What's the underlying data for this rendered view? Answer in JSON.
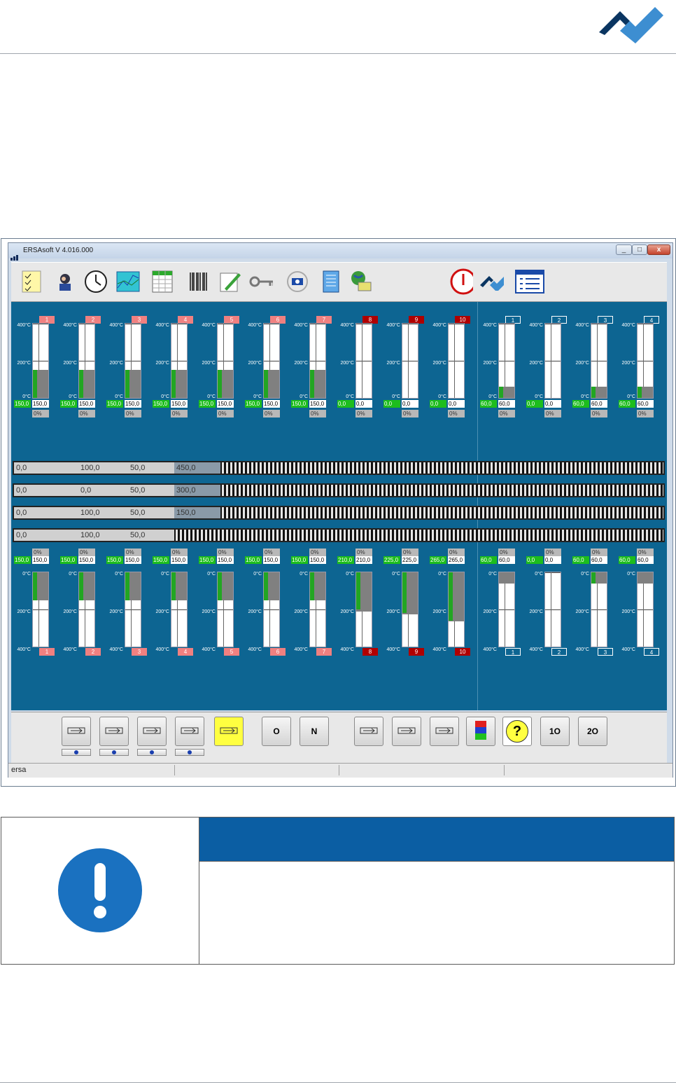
{
  "app": {
    "title": "ERSAsoft V 4.016.000",
    "status_text": "ersa"
  },
  "window_controls": {
    "minimize": "_",
    "maximize": "□",
    "close": "x"
  },
  "colors": {
    "panel_bg": "#0d6592",
    "accent_blue": "#0b5ea3",
    "logo_dark": "#0a3561",
    "logo_light": "#3d8ed1"
  },
  "toolbar_icons": [
    "checklist-icon",
    "operator-icon",
    "clock-icon",
    "profile-chart-icon",
    "spreadsheet-icon",
    "barcode-icon",
    "edit-pencil-icon",
    "key-icon",
    "camera-cycle-icon",
    "notes-icon",
    "network-icon",
    "power-stop-icon",
    "ersa-logo-icon",
    "list-view-icon"
  ],
  "top_zones": [
    {
      "num": "1",
      "color": "pink",
      "set": "150,0",
      "act": "150,0",
      "pct": "0%",
      "fill": 0.375,
      "green": 0.375
    },
    {
      "num": "2",
      "color": "pink",
      "set": "150,0",
      "act": "150,0",
      "pct": "0%",
      "fill": 0.375,
      "green": 0.375
    },
    {
      "num": "3",
      "color": "pink",
      "set": "150,0",
      "act": "150,0",
      "pct": "0%",
      "fill": 0.375,
      "green": 0.375
    },
    {
      "num": "4",
      "color": "pink",
      "set": "150,0",
      "act": "150,0",
      "pct": "0%",
      "fill": 0.375,
      "green": 0.375
    },
    {
      "num": "5",
      "color": "pink",
      "set": "150,0",
      "act": "150,0",
      "pct": "0%",
      "fill": 0.375,
      "green": 0.375
    },
    {
      "num": "6",
      "color": "pink",
      "set": "150,0",
      "act": "150,0",
      "pct": "0%",
      "fill": 0.375,
      "green": 0.375
    },
    {
      "num": "7",
      "color": "pink",
      "set": "150,0",
      "act": "150,0",
      "pct": "0%",
      "fill": 0.375,
      "green": 0.375
    },
    {
      "num": "8",
      "color": "red",
      "set": "0,0",
      "act": "0,0",
      "pct": "0%",
      "fill": 0,
      "green": 0
    },
    {
      "num": "9",
      "color": "red",
      "set": "0,0",
      "act": "0,0",
      "pct": "0%",
      "fill": 0,
      "green": 0
    },
    {
      "num": "10",
      "color": "red",
      "set": "0,0",
      "act": "0,0",
      "pct": "0%",
      "fill": 0,
      "green": 0
    },
    {
      "num": "1",
      "color": "blue",
      "set": "60,0",
      "act": "60,0",
      "pct": "0%",
      "fill": 0.15,
      "green": 0.15
    },
    {
      "num": "2",
      "color": "blue",
      "set": "0,0",
      "act": "0,0",
      "pct": "0%",
      "fill": 0,
      "green": 0
    },
    {
      "num": "3",
      "color": "blue",
      "set": "60,0",
      "act": "60,0",
      "pct": "0%",
      "fill": 0.15,
      "green": 0.15
    },
    {
      "num": "4",
      "color": "blue",
      "set": "60,0",
      "act": "60,0",
      "pct": "0%",
      "fill": 0.15,
      "green": 0.15
    }
  ],
  "bottom_zones": [
    {
      "num": "1",
      "color": "pink",
      "set": "150,0",
      "act": "150,0",
      "pct": "0%",
      "fill": 0.375,
      "green": 0.375
    },
    {
      "num": "2",
      "color": "pink",
      "set": "150,0",
      "act": "150,0",
      "pct": "0%",
      "fill": 0.375,
      "green": 0.375
    },
    {
      "num": "3",
      "color": "pink",
      "set": "150,0",
      "act": "150,0",
      "pct": "0%",
      "fill": 0.375,
      "green": 0.375
    },
    {
      "num": "4",
      "color": "pink",
      "set": "150,0",
      "act": "150,0",
      "pct": "0%",
      "fill": 0.375,
      "green": 0.375
    },
    {
      "num": "5",
      "color": "pink",
      "set": "150,0",
      "act": "150,0",
      "pct": "0%",
      "fill": 0.375,
      "green": 0.375
    },
    {
      "num": "6",
      "color": "pink",
      "set": "150,0",
      "act": "150,0",
      "pct": "0%",
      "fill": 0.375,
      "green": 0.375
    },
    {
      "num": "7",
      "color": "pink",
      "set": "150,0",
      "act": "150,0",
      "pct": "0%",
      "fill": 0.375,
      "green": 0.375
    },
    {
      "num": "8",
      "color": "red",
      "set": "210,0",
      "act": "210,0",
      "pct": "0%",
      "fill": 0.525,
      "green": 0.5
    },
    {
      "num": "9",
      "color": "red",
      "set": "225,0",
      "act": "225,0",
      "pct": "0%",
      "fill": 0.5625,
      "green": 0.55
    },
    {
      "num": "10",
      "color": "red",
      "set": "265,0",
      "act": "265,0",
      "pct": "0%",
      "fill": 0.6625,
      "green": 0.65
    },
    {
      "num": "1",
      "color": "blue",
      "set": "60,0",
      "act": "60,0",
      "pct": "0%",
      "fill": 0.15,
      "green": 0
    },
    {
      "num": "2",
      "color": "blue",
      "set": "0,0",
      "act": "0,0",
      "pct": "0%",
      "fill": 0,
      "green": 0
    },
    {
      "num": "3",
      "color": "blue",
      "set": "60,0",
      "act": "60,0",
      "pct": "0%",
      "fill": 0.15,
      "green": 0.15
    },
    {
      "num": "4",
      "color": "blue",
      "set": "60,0",
      "act": "60,0",
      "pct": "0%",
      "fill": 0.15,
      "green": 0
    }
  ],
  "scale_labels": {
    "top": "400°C",
    "mid": "200°C",
    "zero": "0°C"
  },
  "conveyors": [
    {
      "v1": "0,0",
      "v2": "100,0",
      "v3": "50,0",
      "v4": "450,0"
    },
    {
      "v1": "0,0",
      "v2": "0,0",
      "v3": "50,0",
      "v4": "300,0"
    },
    {
      "v1": "0,0",
      "v2": "100,0",
      "v3": "50,0",
      "v4": "150,0"
    },
    {
      "v1": "0,0",
      "v2": "100,0",
      "v3": "50,0",
      "v4": ""
    }
  ],
  "bottom_buttons": [
    {
      "icon": "conveyor-start-icon",
      "label": "",
      "has_sub": true
    },
    {
      "icon": "transport-arrows-icon",
      "label": "",
      "has_sub": true
    },
    {
      "icon": "pcb-board-icon",
      "label": "",
      "has_sub": true
    },
    {
      "icon": "chain-conveyor-icon",
      "label": "",
      "has_sub": true
    },
    {
      "icon": "yellow-note-icon",
      "label": "",
      "has_sub": false
    },
    {
      "icon": "oxygen-icon",
      "label": "O",
      "has_sub": false
    },
    {
      "icon": "nitrogen-icon",
      "label": "N",
      "has_sub": false
    },
    {
      "icon": "tools-icon",
      "label": "",
      "has_sub": false
    },
    {
      "icon": "conveyor-settings-icon",
      "label": "",
      "has_sub": false
    },
    {
      "icon": "heater-module-icon",
      "label": "",
      "has_sub": false
    },
    {
      "icon": "signal-tower-icon",
      "label": "",
      "has_sub": false
    },
    {
      "icon": "help-icon",
      "label": "?",
      "has_sub": false
    },
    {
      "icon": "oxygen-sensor-1-icon",
      "label": "1O",
      "has_sub": false
    },
    {
      "icon": "oxygen-sensor-2-icon",
      "label": "2O",
      "has_sub": false
    }
  ],
  "notice": {
    "header_text": "",
    "body_text": ""
  }
}
